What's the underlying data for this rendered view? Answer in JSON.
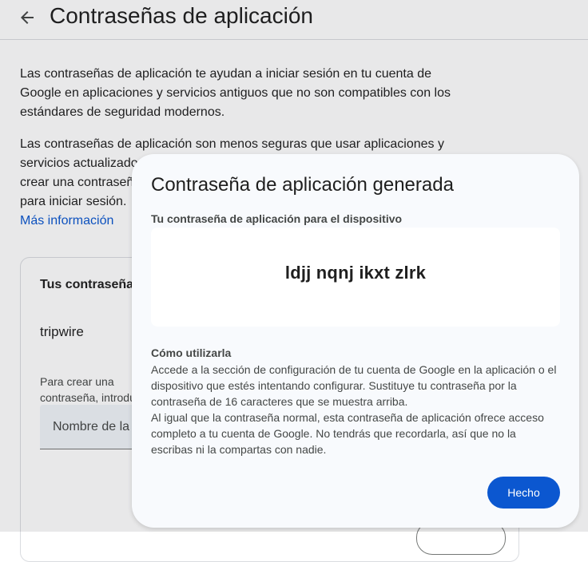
{
  "header": {
    "title": "Contraseñas de aplicación",
    "back_icon": "arrow-back-icon"
  },
  "intro": {
    "paragraph_1": "Las contraseñas de aplicación te ayudan a iniciar sesión en tu cuenta de Google en aplicaciones y servicios antiguos que no son compatibles con los estándares de seguridad modernos.",
    "paragraph_2": "Las contraseñas de aplicación son menos seguras que usar aplicaciones y servicios actualizados que usen estándares de seguridad modernos. Antes de crear una contraseña de aplicación, comprueba si tu aplicación la necesita para iniciar sesión.",
    "more_info_link": "Más información"
  },
  "card": {
    "title": "Tus contraseñas de aplicación",
    "app_name": "tripwire",
    "hint": "Para crear una contraseña, introduce el nombre a continuación...",
    "name_placeholder": "Nombre de la aplicación"
  },
  "dialog": {
    "title": "Contraseña de aplicación generada",
    "password_label": "Tu contraseña de aplicación para el dispositivo",
    "password_value": "ldjj nqnj ikxt zlrk",
    "how_to_title": "Cómo utilizarla",
    "how_to_text_1": "Accede a la sección de configuración de tu cuenta de Google en la aplicación o el dispositivo que estés intentando configurar. Sustituye tu contraseña por la contraseña de 16 caracteres que se muestra arriba.",
    "how_to_text_2": "Al igual que la contraseña normal, esta contraseña de aplicación ofrece acceso completo a tu cuenta de Google. No tendrás que recordarla, así que no la escribas ni la compartas con nadie.",
    "done_label": "Hecho"
  },
  "colors": {
    "accent": "#0b57d0",
    "dialog_bg": "#f8fafd",
    "text_primary": "#1f1f1f",
    "text_secondary": "#444746"
  }
}
